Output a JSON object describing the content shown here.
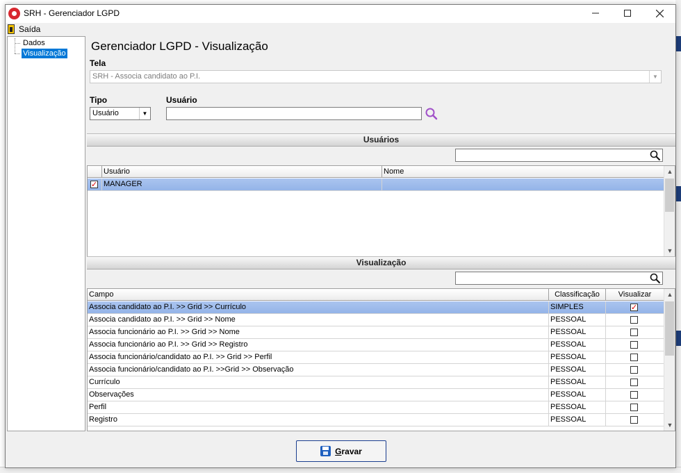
{
  "window": {
    "title": "SRH - Gerenciador LGPD"
  },
  "menu": {
    "exit_label": "Saída"
  },
  "tree": {
    "items": [
      "Dados",
      "Visualização"
    ],
    "selected": "Visualização"
  },
  "page_title": "Gerenciador LGPD - Visualização",
  "tela": {
    "label": "Tela",
    "value": "SRH - Associa candidato ao P.I."
  },
  "tipo": {
    "label": "Tipo",
    "value": "Usuário"
  },
  "usuario": {
    "label": "Usuário",
    "value": ""
  },
  "usuarios_section": {
    "title": "Usuários",
    "filter_value": "",
    "columns": [
      "Usuário",
      "Nome"
    ],
    "rows": [
      {
        "checked": true,
        "usuario": "MANAGER",
        "nome": ""
      }
    ]
  },
  "visualizacao_section": {
    "title": "Visualização",
    "filter_value": "",
    "columns": [
      "Campo",
      "Classificação",
      "Visualizar"
    ],
    "rows": [
      {
        "campo": "Associa candidato ao P.I. >> Grid >> Currículo",
        "classificacao": "SIMPLES",
        "visualizar": true
      },
      {
        "campo": "Associa candidato ao P.I. >> Grid >> Nome",
        "classificacao": "PESSOAL",
        "visualizar": false
      },
      {
        "campo": "Associa funcionário ao P.I. >> Grid >> Nome",
        "classificacao": "PESSOAL",
        "visualizar": false
      },
      {
        "campo": "Associa funcionário ao P.I. >> Grid >> Registro",
        "classificacao": "PESSOAL",
        "visualizar": false
      },
      {
        "campo": "Associa funcionário/candidato ao P.I. >> Grid >> Perfil",
        "classificacao": "PESSOAL",
        "visualizar": false
      },
      {
        "campo": "Associa funcionário/candidato ao P.I. >>Grid >> Observação",
        "classificacao": "PESSOAL",
        "visualizar": false
      },
      {
        "campo": "Currículo",
        "classificacao": "PESSOAL",
        "visualizar": false
      },
      {
        "campo": "Observações",
        "classificacao": "PESSOAL",
        "visualizar": false
      },
      {
        "campo": "Perfil",
        "classificacao": "PESSOAL",
        "visualizar": false
      },
      {
        "campo": "Registro",
        "classificacao": "PESSOAL",
        "visualizar": false
      }
    ]
  },
  "footer": {
    "save_label": "Gravar"
  },
  "colors": {
    "selection": "#94b4e8",
    "accent": "#0078d7",
    "check": "#dd0000",
    "search_icon": "#a050c8"
  }
}
